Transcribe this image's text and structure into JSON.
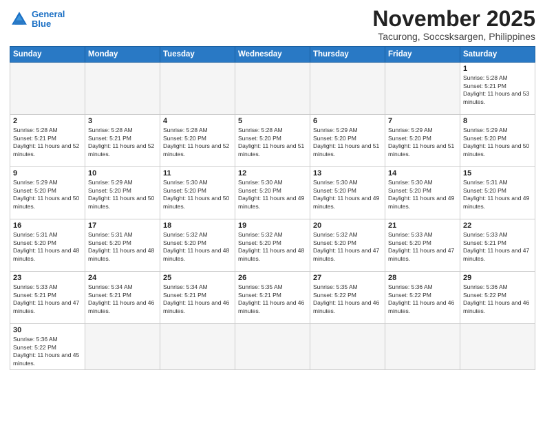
{
  "logo": {
    "line1": "General",
    "line2": "Blue"
  },
  "title": "November 2025",
  "location": "Tacurong, Soccsksargen, Philippines",
  "days_of_week": [
    "Sunday",
    "Monday",
    "Tuesday",
    "Wednesday",
    "Thursday",
    "Friday",
    "Saturday"
  ],
  "weeks": [
    [
      {
        "day": "",
        "empty": true
      },
      {
        "day": "",
        "empty": true
      },
      {
        "day": "",
        "empty": true
      },
      {
        "day": "",
        "empty": true
      },
      {
        "day": "",
        "empty": true
      },
      {
        "day": "",
        "empty": true
      },
      {
        "day": "1",
        "sunrise": "5:28 AM",
        "sunset": "5:21 PM",
        "daylight": "11 hours and 53 minutes."
      }
    ],
    [
      {
        "day": "2",
        "sunrise": "5:28 AM",
        "sunset": "5:21 PM",
        "daylight": "11 hours and 52 minutes."
      },
      {
        "day": "3",
        "sunrise": "5:28 AM",
        "sunset": "5:21 PM",
        "daylight": "11 hours and 52 minutes."
      },
      {
        "day": "4",
        "sunrise": "5:28 AM",
        "sunset": "5:20 PM",
        "daylight": "11 hours and 52 minutes."
      },
      {
        "day": "5",
        "sunrise": "5:28 AM",
        "sunset": "5:20 PM",
        "daylight": "11 hours and 51 minutes."
      },
      {
        "day": "6",
        "sunrise": "5:29 AM",
        "sunset": "5:20 PM",
        "daylight": "11 hours and 51 minutes."
      },
      {
        "day": "7",
        "sunrise": "5:29 AM",
        "sunset": "5:20 PM",
        "daylight": "11 hours and 51 minutes."
      },
      {
        "day": "8",
        "sunrise": "5:29 AM",
        "sunset": "5:20 PM",
        "daylight": "11 hours and 50 minutes."
      }
    ],
    [
      {
        "day": "9",
        "sunrise": "5:29 AM",
        "sunset": "5:20 PM",
        "daylight": "11 hours and 50 minutes."
      },
      {
        "day": "10",
        "sunrise": "5:29 AM",
        "sunset": "5:20 PM",
        "daylight": "11 hours and 50 minutes."
      },
      {
        "day": "11",
        "sunrise": "5:30 AM",
        "sunset": "5:20 PM",
        "daylight": "11 hours and 50 minutes."
      },
      {
        "day": "12",
        "sunrise": "5:30 AM",
        "sunset": "5:20 PM",
        "daylight": "11 hours and 49 minutes."
      },
      {
        "day": "13",
        "sunrise": "5:30 AM",
        "sunset": "5:20 PM",
        "daylight": "11 hours and 49 minutes."
      },
      {
        "day": "14",
        "sunrise": "5:30 AM",
        "sunset": "5:20 PM",
        "daylight": "11 hours and 49 minutes."
      },
      {
        "day": "15",
        "sunrise": "5:31 AM",
        "sunset": "5:20 PM",
        "daylight": "11 hours and 49 minutes."
      }
    ],
    [
      {
        "day": "16",
        "sunrise": "5:31 AM",
        "sunset": "5:20 PM",
        "daylight": "11 hours and 48 minutes."
      },
      {
        "day": "17",
        "sunrise": "5:31 AM",
        "sunset": "5:20 PM",
        "daylight": "11 hours and 48 minutes."
      },
      {
        "day": "18",
        "sunrise": "5:32 AM",
        "sunset": "5:20 PM",
        "daylight": "11 hours and 48 minutes."
      },
      {
        "day": "19",
        "sunrise": "5:32 AM",
        "sunset": "5:20 PM",
        "daylight": "11 hours and 48 minutes."
      },
      {
        "day": "20",
        "sunrise": "5:32 AM",
        "sunset": "5:20 PM",
        "daylight": "11 hours and 47 minutes."
      },
      {
        "day": "21",
        "sunrise": "5:33 AM",
        "sunset": "5:20 PM",
        "daylight": "11 hours and 47 minutes."
      },
      {
        "day": "22",
        "sunrise": "5:33 AM",
        "sunset": "5:21 PM",
        "daylight": "11 hours and 47 minutes."
      }
    ],
    [
      {
        "day": "23",
        "sunrise": "5:33 AM",
        "sunset": "5:21 PM",
        "daylight": "11 hours and 47 minutes."
      },
      {
        "day": "24",
        "sunrise": "5:34 AM",
        "sunset": "5:21 PM",
        "daylight": "11 hours and 46 minutes."
      },
      {
        "day": "25",
        "sunrise": "5:34 AM",
        "sunset": "5:21 PM",
        "daylight": "11 hours and 46 minutes."
      },
      {
        "day": "26",
        "sunrise": "5:35 AM",
        "sunset": "5:21 PM",
        "daylight": "11 hours and 46 minutes."
      },
      {
        "day": "27",
        "sunrise": "5:35 AM",
        "sunset": "5:22 PM",
        "daylight": "11 hours and 46 minutes."
      },
      {
        "day": "28",
        "sunrise": "5:36 AM",
        "sunset": "5:22 PM",
        "daylight": "11 hours and 46 minutes."
      },
      {
        "day": "29",
        "sunrise": "5:36 AM",
        "sunset": "5:22 PM",
        "daylight": "11 hours and 46 minutes."
      }
    ],
    [
      {
        "day": "30",
        "sunrise": "5:36 AM",
        "sunset": "5:22 PM",
        "daylight": "11 hours and 45 minutes."
      },
      {
        "day": "",
        "empty": true
      },
      {
        "day": "",
        "empty": true
      },
      {
        "day": "",
        "empty": true
      },
      {
        "day": "",
        "empty": true
      },
      {
        "day": "",
        "empty": true
      },
      {
        "day": "",
        "empty": true
      }
    ]
  ]
}
